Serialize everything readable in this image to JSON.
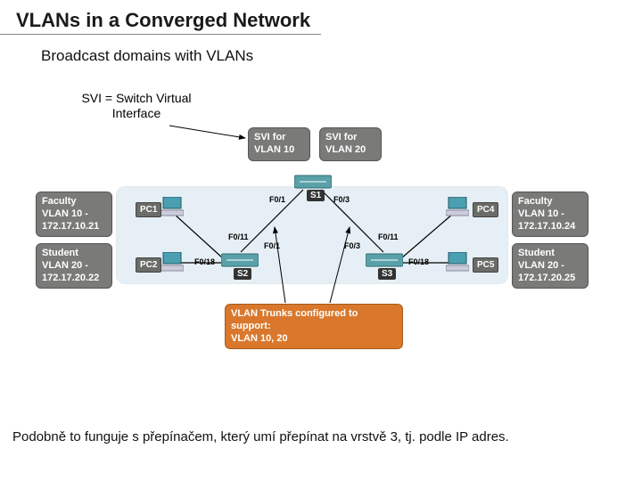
{
  "title": "VLANs in a Converged Network",
  "subtitle": "Broadcast domains with VLANs",
  "svi_label_l1": "SVI = Switch Virtual",
  "svi_label_l2": "Interface",
  "svi_for": "SVI for",
  "vlan10": "VLAN 10",
  "vlan20": "VLAN 20",
  "faculty": "Faculty",
  "student": "Student",
  "fac_left_l2": "VLAN 10 -",
  "fac_left_l3": "172.17.10.21",
  "stu_left_l2": "VLAN 20 -",
  "stu_left_l3": "172.17.20.22",
  "fac_right_l2": "VLAN 10 -",
  "fac_right_l3": "172.17.10.24",
  "stu_right_l2": "VLAN 20 -",
  "stu_right_l3": "172.17.20.25",
  "pc1": "PC1",
  "pc2": "PC2",
  "pc4": "PC4",
  "pc5": "PC5",
  "s1": "S1",
  "s2": "S2",
  "s3": "S3",
  "p_f01": "F0/1",
  "p_f03": "F0/3",
  "p_f011": "F0/11",
  "p_f018": "F0/18",
  "trunk_l1": "VLAN Trunks configured to support:",
  "trunk_l2": "VLAN 10, 20",
  "footer": "Podobně to funguje s přepínačem, který umí přepínat na vrstvě 3, tj. podle IP adres."
}
